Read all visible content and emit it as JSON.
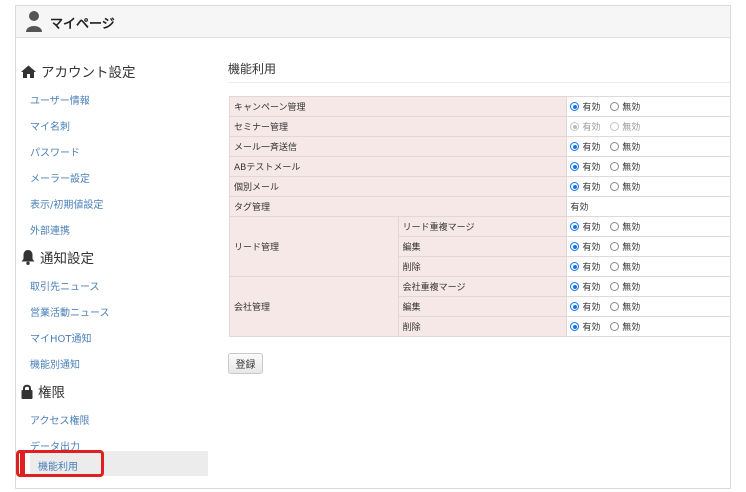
{
  "header": {
    "title": "マイページ"
  },
  "sidebar": {
    "sections": [
      {
        "title": "アカウント設定",
        "icon": "home-icon",
        "items": [
          "ユーザー情報",
          "マイ名刺",
          "パスワード",
          "メーラー設定",
          "表示/初期値設定",
          "外部連携"
        ]
      },
      {
        "title": "通知設定",
        "icon": "bell-icon",
        "items": [
          "取引先ニュース",
          "営業活動ニュース",
          "マイHOT通知",
          "機能別通知"
        ]
      },
      {
        "title": "権限",
        "icon": "lock-icon",
        "items": [
          "アクセス権限",
          "データ出力",
          "機能利用"
        ]
      }
    ],
    "active_item": "機能利用"
  },
  "main": {
    "title": "機能利用",
    "radio_on_label": "有効",
    "radio_off_label": "無効",
    "rows": {
      "campaign": {
        "label": "キャンペーン管理",
        "selected": "有効"
      },
      "seminar": {
        "label": "セミナー管理",
        "selected": "有効",
        "disabled": true
      },
      "bulk_mail": {
        "label": "メール一斉送信",
        "selected": "有効"
      },
      "ab_test": {
        "label": "ABテストメール",
        "selected": "有効"
      },
      "individual_mail": {
        "label": "個別メール",
        "selected": "有効"
      },
      "tag": {
        "label": "タグ管理",
        "value": "有効"
      },
      "lead": {
        "label": "リード管理",
        "subs": [
          "リード重複マージ",
          "編集",
          "削除"
        ]
      },
      "company": {
        "label": "会社管理",
        "subs": [
          "会社重複マージ",
          "編集",
          "削除"
        ]
      }
    },
    "register_label": "登録"
  },
  "colors": {
    "accent": "#1a73e8",
    "link": "#4a7fb8",
    "label_bg": "#f7e8e8",
    "highlight": "#e02020"
  }
}
